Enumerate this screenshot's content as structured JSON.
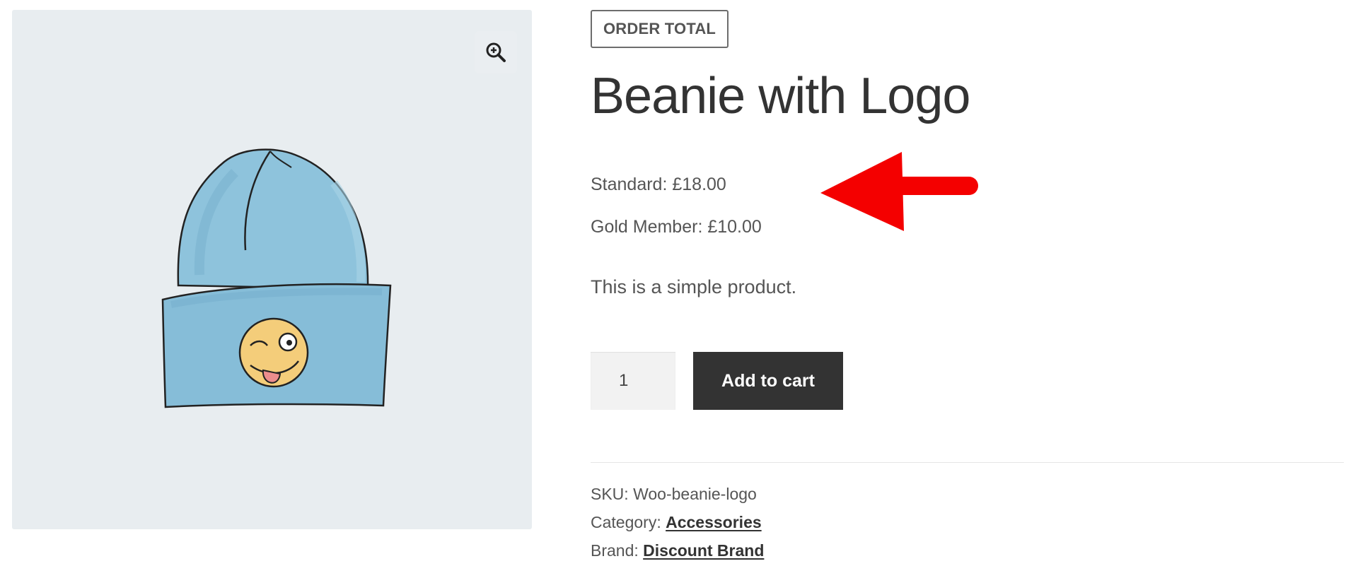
{
  "gallery": {
    "zoom_icon": "magnifier-plus-icon",
    "image": "beanie-with-logo-illustration",
    "background_color": "#e8edf0"
  },
  "product": {
    "badge": "ORDER TOTAL",
    "title": "Beanie with Logo",
    "prices": {
      "standard": "Standard: £18.00",
      "gold": "Gold Member: £10.00"
    },
    "description": "This is a simple product.",
    "annotation_arrow_color": "#f40000"
  },
  "cart": {
    "quantity": "1",
    "add_to_cart_label": "Add to cart",
    "button_color": "#333333"
  },
  "meta": {
    "sku_label": "SKU:",
    "sku_value": "Woo-beanie-logo",
    "category_label": "Category:",
    "category_value": "Accessories",
    "brand_label": "Brand:",
    "brand_value": "Discount Brand"
  }
}
